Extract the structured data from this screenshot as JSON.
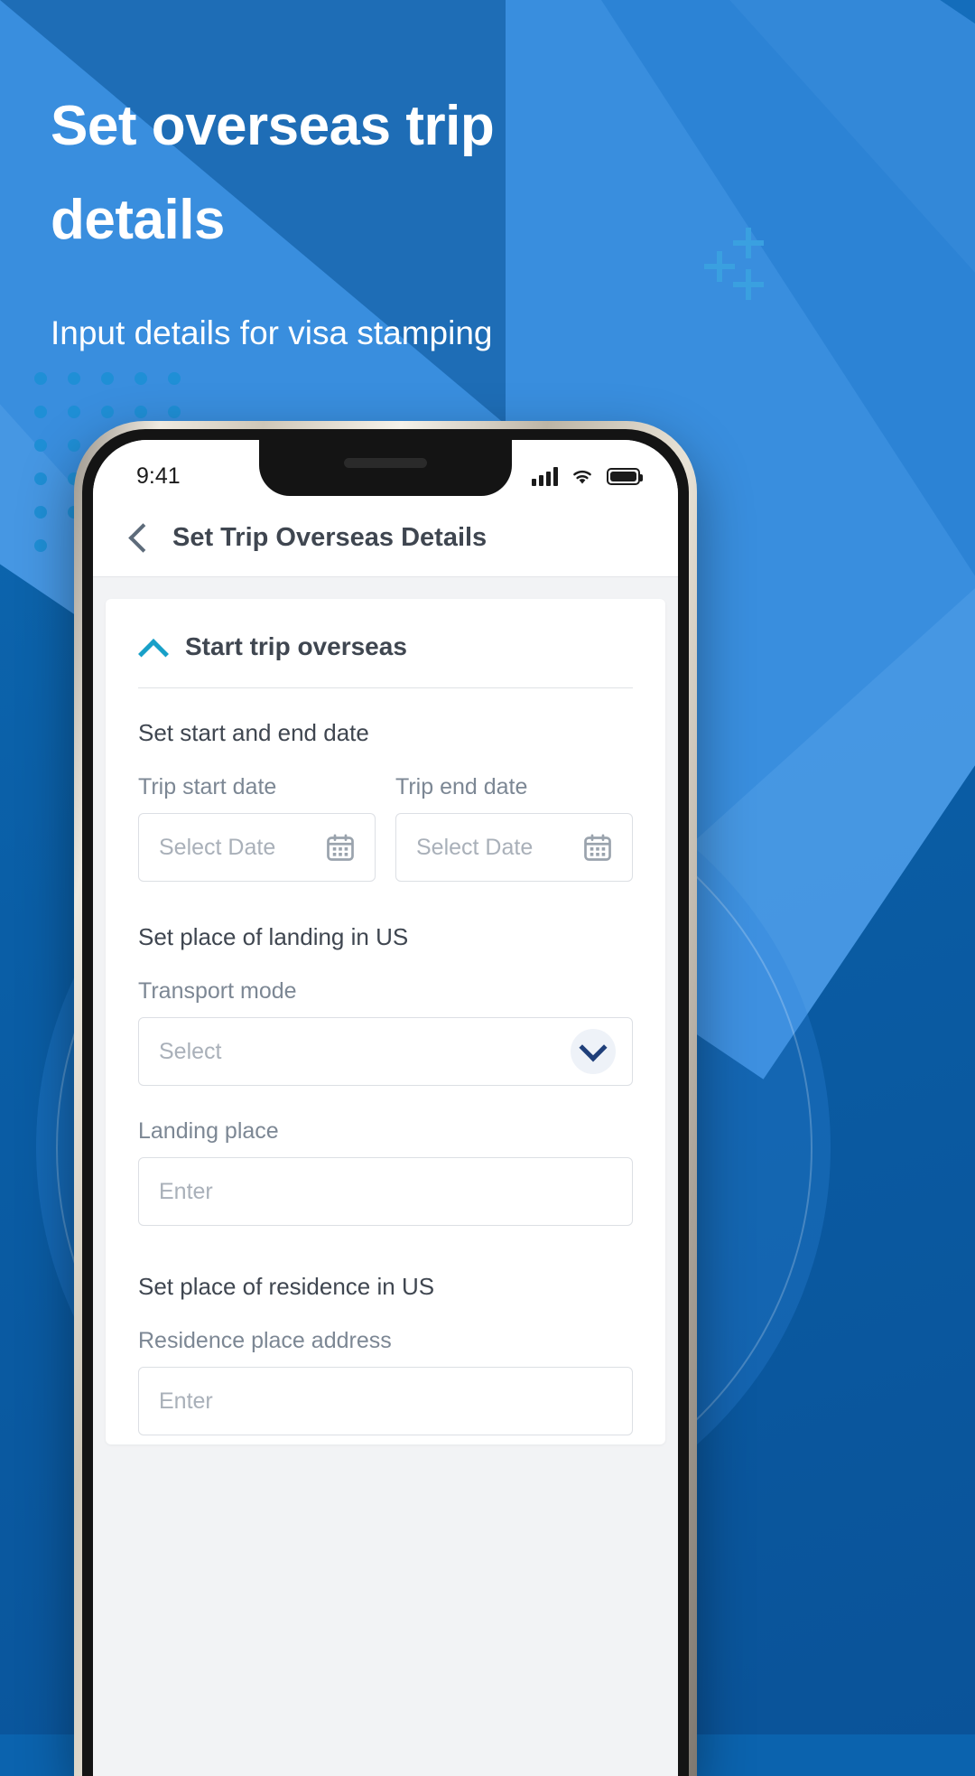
{
  "hero": {
    "title_line1": "Set overseas trip",
    "title_line2": "details",
    "subtitle": "Input details for visa stamping"
  },
  "phone": {
    "statusbar": {
      "time": "9:41",
      "signal_icon": "cellular-signal-icon",
      "wifi_icon": "wifi-icon",
      "battery_icon": "battery-icon"
    },
    "navbar": {
      "back_icon": "back-chevron-icon",
      "title": "Set Trip Overseas Details"
    },
    "accordion": {
      "chevron_icon": "chevron-up-icon",
      "title": "Start trip overseas"
    },
    "sections": {
      "dates_heading": "Set start and end date",
      "landing_heading": "Set place of landing in US",
      "residence_heading": "Set place of residence in US"
    },
    "fields": {
      "trip_start_date": {
        "label": "Trip start date",
        "placeholder": "Select Date",
        "icon": "calendar-icon"
      },
      "trip_end_date": {
        "label": "Trip end date",
        "placeholder": "Select Date",
        "icon": "calendar-icon"
      },
      "transport_mode": {
        "label": "Transport mode",
        "placeholder": "Select",
        "icon": "chevron-down-icon"
      },
      "landing_place": {
        "label": "Landing place",
        "placeholder": "Enter"
      },
      "residence_place_address": {
        "label": "Residence place address",
        "placeholder": "Enter"
      }
    }
  },
  "colors": {
    "bg_blue": "#0a5ea6",
    "bg_light_blue": "#4a9ae6",
    "accent_cyan": "#18a0c8",
    "dot_blue": "#1f8fd6",
    "plus_blue": "#3aa0e0",
    "text_dark": "#3f4650",
    "text_muted": "#7c8794",
    "placeholder": "#a9b0b9"
  }
}
